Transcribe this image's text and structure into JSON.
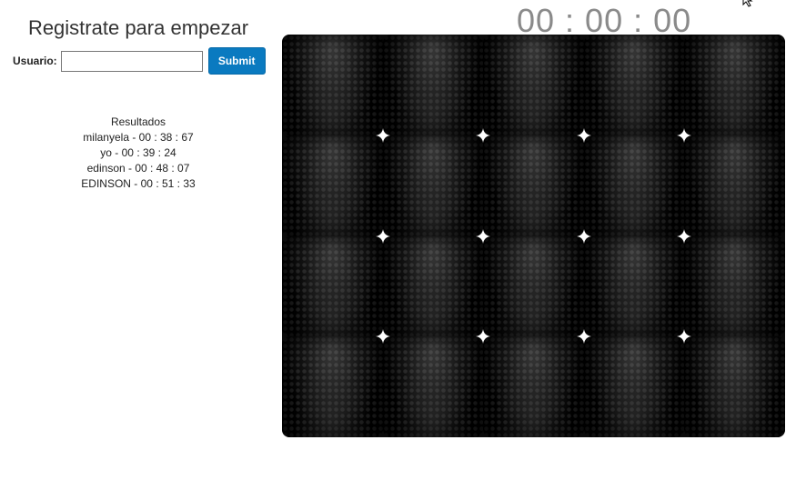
{
  "header": {
    "title": "Registrate para empezar"
  },
  "form": {
    "label": "Usuario:",
    "input_value": "",
    "input_placeholder": "",
    "submit_label": "Submit"
  },
  "results": {
    "heading": "Resultados",
    "entries": [
      "milanyela - 00 : 38 : 67",
      "yo - 00 : 39 : 24",
      "edinson - 00 : 48 : 07",
      "EDINSON - 00 : 51 : 33"
    ]
  },
  "timer": {
    "display": "00 : 00 : 00"
  },
  "board": {
    "columns": 5,
    "rows": 4,
    "card_state": "face-down"
  }
}
